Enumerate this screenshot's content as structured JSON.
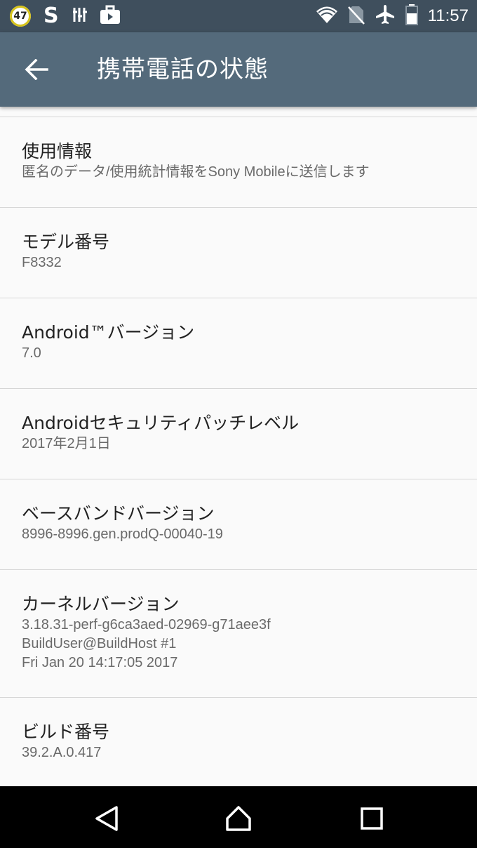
{
  "status_bar": {
    "notification_badge": "47",
    "app_icon_s": "S",
    "time": "11:57",
    "icons": [
      "wifi-icon",
      "no-sim-icon",
      "airplane-icon",
      "battery-icon"
    ]
  },
  "app_bar": {
    "back_icon": "arrow-left-icon",
    "title": "携帯電話の状態"
  },
  "items": [
    {
      "title": "使用情報",
      "lines": [
        "匿名のデータ/使用統計情報をSony Mobileに送信します"
      ]
    },
    {
      "title": "モデル番号",
      "lines": [
        "F8332"
      ]
    },
    {
      "title": "Android™バージョン",
      "lines": [
        "7.0"
      ]
    },
    {
      "title": "Androidセキュリティパッチレベル",
      "lines": [
        "2017年2月1日"
      ]
    },
    {
      "title": "ベースバンドバージョン",
      "lines": [
        "8996-8996.gen.prodQ-00040-19"
      ]
    },
    {
      "title": "カーネルバージョン",
      "lines": [
        "3.18.31-perf-g6ca3aed-02969-g71aee3f",
        "BuildUser@BuildHost #1",
        "Fri Jan 20 14:17:05 2017"
      ]
    },
    {
      "title": "ビルド番号",
      "lines": [
        "39.2.A.0.417"
      ]
    }
  ],
  "nav_bar": {
    "buttons": [
      "back-triangle-icon",
      "home-icon",
      "recents-square-icon"
    ]
  }
}
